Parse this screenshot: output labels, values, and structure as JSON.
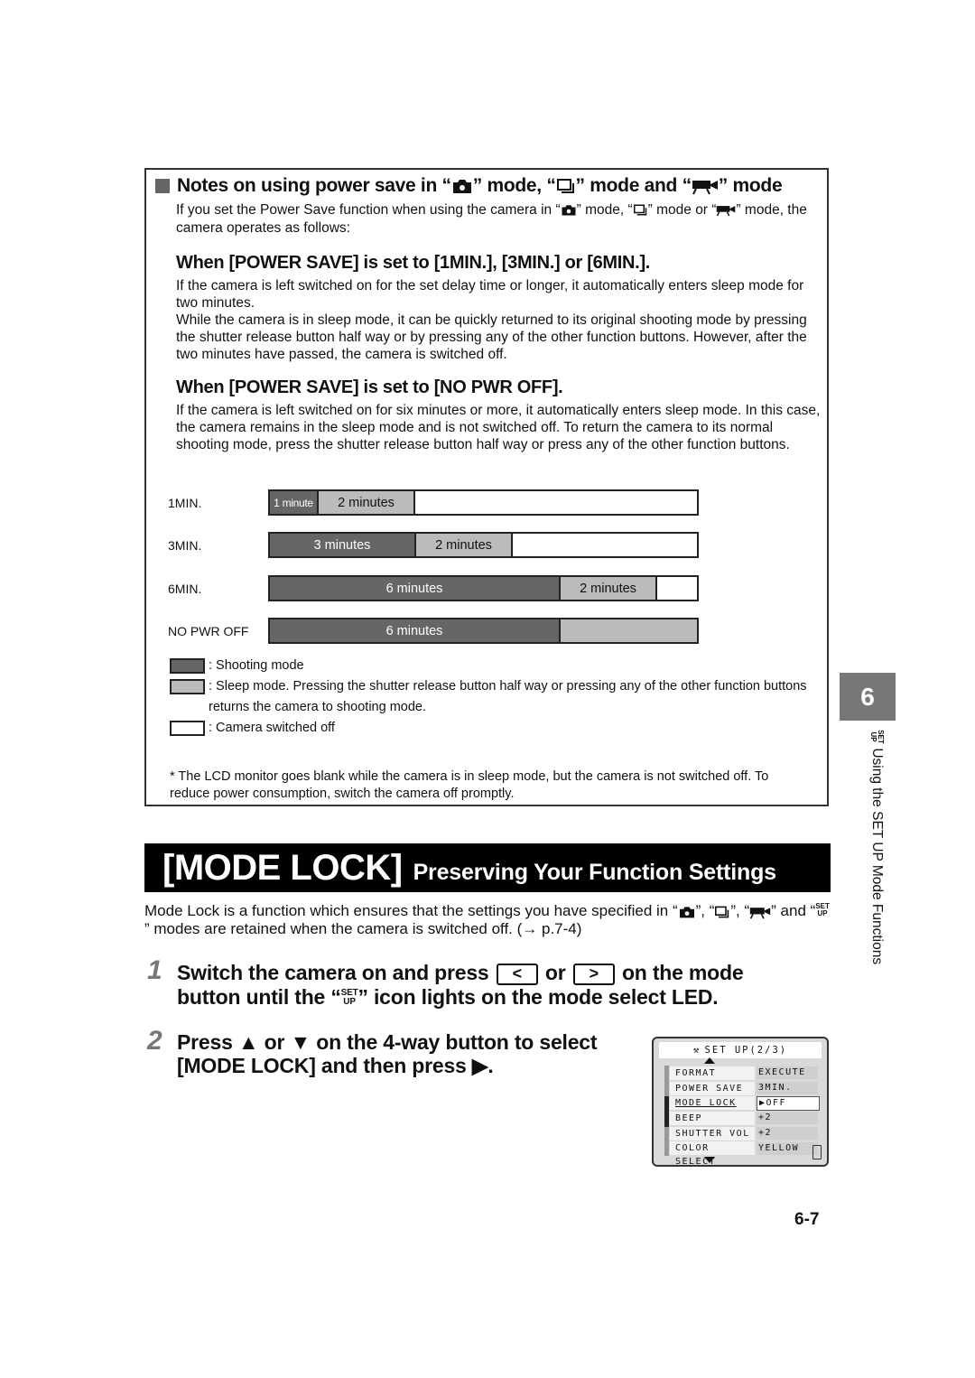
{
  "notes": {
    "title_parts": [
      "Notes on using power save in “",
      "” mode, “",
      "” mode and “",
      "” mode"
    ],
    "title_icons": [
      "camera-icon",
      "continuous-shooting-icon",
      "movie-icon"
    ],
    "intro_parts": [
      "If you set the Power Save function when using the camera in “",
      "” mode, “",
      "” mode or “",
      "” mode, the camera operates as follows:"
    ],
    "section1_heading": "When [POWER SAVE] is set to [1MIN.], [3MIN.] or [6MIN.].",
    "section1_body_p1": "If the camera is left switched on for the set delay time or longer, it automatically enters sleep mode for two minutes.",
    "section1_body_p2": "While the camera is in sleep mode, it can be quickly returned to its original shooting mode by pressing the shutter release button half way or by pressing any of the other function buttons. However, after the two minutes have passed, the camera is switched off.",
    "section2_heading": "When [POWER SAVE] is set to [NO PWR OFF].",
    "section2_body": "If the camera is left switched on for six minutes or more, it automatically enters sleep mode. In this case, the camera remains in the sleep mode and is not switched off. To return the camera to its normal shooting mode, press the shutter release button half way or press any of the other function buttons.",
    "timeline": {
      "rows": [
        {
          "label": "1MIN.",
          "segments": [
            {
              "type": "shooting",
              "text": "1 minute",
              "minutes": 1
            },
            {
              "type": "sleep",
              "text": "2 minutes",
              "minutes": 2
            },
            {
              "type": "off",
              "text": ""
            }
          ]
        },
        {
          "label": "3MIN.",
          "segments": [
            {
              "type": "shooting",
              "text": "3 minutes",
              "minutes": 3
            },
            {
              "type": "sleep",
              "text": "2 minutes",
              "minutes": 2
            },
            {
              "type": "off",
              "text": ""
            }
          ]
        },
        {
          "label": "6MIN.",
          "segments": [
            {
              "type": "shooting",
              "text": "6 minutes",
              "minutes": 6
            },
            {
              "type": "sleep",
              "text": "2 minutes",
              "minutes": 2
            },
            {
              "type": "off",
              "text": ""
            }
          ]
        },
        {
          "label": "NO PWR OFF",
          "segments": [
            {
              "type": "shooting",
              "text": "6 minutes",
              "minutes": 6
            },
            {
              "type": "sleep",
              "text": ""
            }
          ]
        }
      ],
      "legend": {
        "shooting": ": Shooting mode",
        "sleep": ": Sleep mode. Pressing the shutter release button half way or pressing any of the other function buttons returns the camera to shooting mode.",
        "off": ": Camera switched off"
      },
      "colors": {
        "shooting": "#666666",
        "sleep": "#bbbbbb",
        "off": "#ffffff"
      }
    },
    "footnote": "* The LCD monitor goes blank while the camera is in sleep mode, but the camera is not switched off. To reduce power consumption, switch the camera off promptly."
  },
  "section": {
    "title_main": "[MODE LOCK]",
    "title_sub": "Preserving Your Function Settings",
    "intro_parts": [
      "Mode Lock is a function which ensures that the settings you have specified in “",
      "”, “",
      "”, “",
      "” and “",
      "” modes are retained when the camera is switched off. (→ p.7-4)"
    ]
  },
  "steps": [
    {
      "number": "1",
      "parts": [
        "Switch the camera on and press",
        "or",
        "on the mode button until the “",
        "” icon lights on the mode select LED."
      ],
      "keys": [
        "<",
        ">"
      ]
    },
    {
      "number": "2",
      "parts": [
        "Press",
        "or",
        "on the 4-way button to select [MODE LOCK] and then press",
        "."
      ],
      "glyphs": [
        "▲",
        "▼",
        "▶"
      ]
    }
  ],
  "lcd": {
    "title": "SET UP(2/3)",
    "rows": [
      {
        "key": "FORMAT",
        "value": "EXECUTE"
      },
      {
        "key": "POWER SAVE",
        "value": "3MIN."
      },
      {
        "key": "MODE LOCK",
        "value": "OFF",
        "selected": true
      },
      {
        "key": "BEEP",
        "value": "+2"
      },
      {
        "key": "SHUTTER VOL",
        "value": "+2"
      },
      {
        "key": "COLOR SELECT",
        "value": "YELLOW"
      }
    ]
  },
  "side": {
    "chapter": "6",
    "setup_top": "SET",
    "setup_bottom": "UP",
    "label": "Using the SET UP Mode Functions"
  },
  "page_number": "6-7"
}
